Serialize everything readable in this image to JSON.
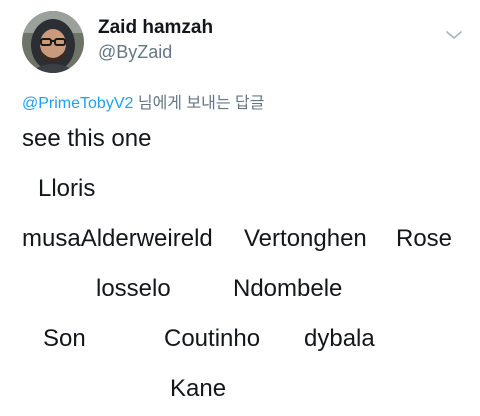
{
  "author": {
    "display_name": "Zaid hamzah",
    "handle": "@ByZaid",
    "avatar_icon": "user-avatar-photo"
  },
  "menu": {
    "icon": "chevron-down-icon"
  },
  "reply_context": {
    "mention": "@PrimeTobyV2",
    "suffix": "님에게 보내는 답글"
  },
  "tweet": {
    "lines": [
      "see this one",
      "Lloris",
      "musaAlderweireld",
      "Vertonghen",
      "Rose",
      "losselo",
      "Ndombele",
      "Son",
      "Coutinho",
      "dybala",
      "Kane"
    ]
  },
  "colors": {
    "link": "#1da1f2",
    "secondary": "#657786",
    "text": "#14171a"
  }
}
